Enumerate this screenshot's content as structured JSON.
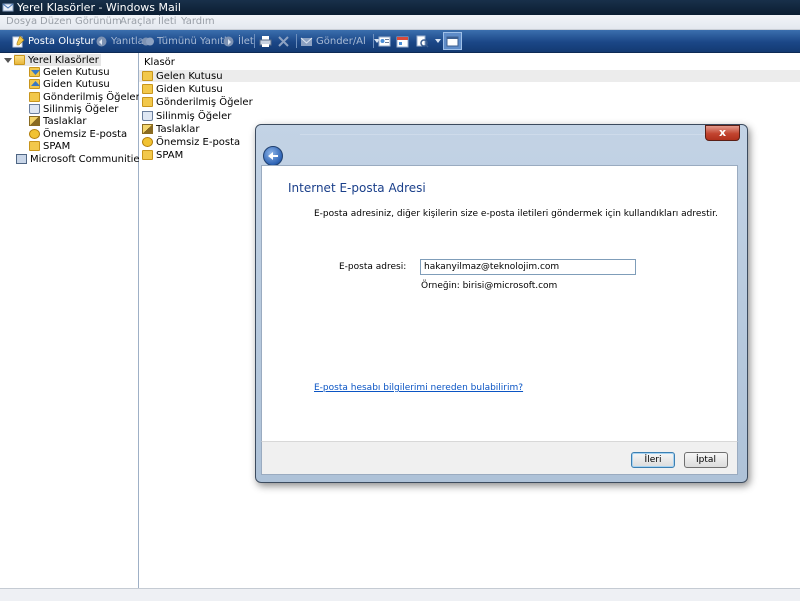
{
  "window": {
    "title": "Yerel Klasörler - Windows Mail"
  },
  "menu": [
    {
      "label": "Dosya",
      "icon": ""
    },
    {
      "label": "Düzen"
    },
    {
      "label": "Görünüm"
    },
    {
      "label": "Araçlar"
    },
    {
      "label": "İleti"
    },
    {
      "label": "Yardım"
    }
  ],
  "toolbar": {
    "new_mail": "Posta Oluştur",
    "reply": "Yanıtla",
    "reply_all": "Tümünü Yanıtla",
    "forward": "İlet",
    "send_receive": "Gönder/Al"
  },
  "folders": {
    "root": "Yerel Klasörler",
    "items": [
      {
        "label": "Gelen Kutusu",
        "icon": "inbox-icon"
      },
      {
        "label": "Giden Kutusu",
        "icon": "outbox-icon"
      },
      {
        "label": "Gönderilmiş Öğeler",
        "icon": "sent-icon"
      },
      {
        "label": "Silinmiş Öğeler",
        "icon": "trash-icon"
      },
      {
        "label": "Taslaklar",
        "icon": "drafts-icon"
      },
      {
        "label": "Önemsiz E-posta",
        "icon": "junk-icon"
      },
      {
        "label": "SPAM",
        "icon": "folder-icon"
      }
    ],
    "communities": "Microsoft Communities"
  },
  "list": {
    "header": "Klasör",
    "rows": [
      {
        "label": "Gelen Kutusu"
      },
      {
        "label": "Giden Kutusu"
      },
      {
        "label": "Gönderilmiş Öğeler"
      },
      {
        "label": "Silinmiş Öğeler"
      },
      {
        "label": "Taslaklar"
      },
      {
        "label": "Önemsiz E-posta"
      },
      {
        "label": "SPAM"
      }
    ]
  },
  "dialog": {
    "close_label": "x",
    "heading": "Internet E-posta Adresi",
    "description": "E-posta adresiniz, diğer kişilerin size e-posta iletileri göndermek için kullandıkları adrestir.",
    "email_label": "E-posta adresi:",
    "email_value": "hakanyilmaz@teknolojim.com",
    "email_example": "Örneğin: birisi@microsoft.com",
    "help_link": "E-posta hesabı bilgilerimi nereden bulabilirim?",
    "next_button": "İleri",
    "cancel_button": "İptal"
  },
  "colors": {
    "toolbar": "#1b4787",
    "titlebar": "#18304a",
    "link": "#0b55c4",
    "heading": "#1a3f8a"
  }
}
